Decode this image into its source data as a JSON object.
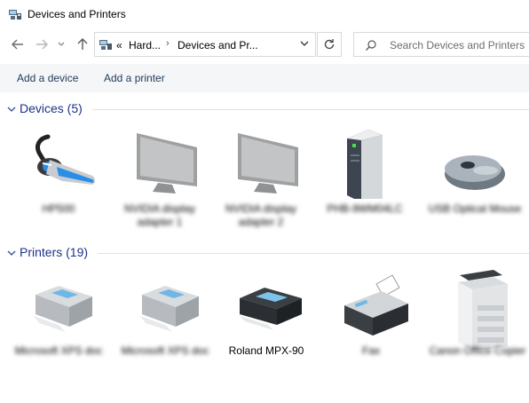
{
  "window": {
    "title": "Devices and Printers"
  },
  "nav": {
    "breadcrumb": [
      {
        "label": "Hard..."
      },
      {
        "label": "Devices and Pr..."
      }
    ],
    "overflow": "«",
    "search_placeholder": "Search Devices and Printers"
  },
  "commands": {
    "add_device": "Add a device",
    "add_printer": "Add a printer"
  },
  "groups": [
    {
      "title": "Devices (5)",
      "items": [
        {
          "label": "HP500",
          "icon": "headset-icon"
        },
        {
          "label": "NVIDIA display adapter 1",
          "icon": "monitor-icon"
        },
        {
          "label": "NVIDIA display adapter 2",
          "icon": "monitor-icon"
        },
        {
          "label": "PHB-9WM04LC",
          "icon": "computer-tower-icon"
        },
        {
          "label": "USB Optical Mouse",
          "icon": "mouse-icon"
        }
      ]
    },
    {
      "title": "Printers (19)",
      "items": [
        {
          "label": "Microsoft XPS doc",
          "icon": "printer-icon"
        },
        {
          "label": "Microsoft XPS doc",
          "icon": "printer-icon"
        },
        {
          "label": "Roland MPX-90",
          "icon": "printer-dark-icon"
        },
        {
          "label": "Fax",
          "icon": "fax-icon"
        },
        {
          "label": "Canon Office Copier",
          "icon": "copier-icon"
        }
      ]
    }
  ]
}
